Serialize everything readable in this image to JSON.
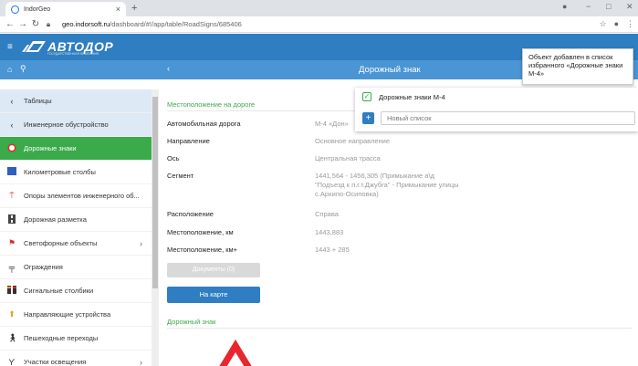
{
  "browser": {
    "tab_title": "IndorGeo",
    "tab_close": "×",
    "new_tab": "+",
    "url_domain": "geo.indorsoft.ru",
    "url_path": "/dashboard/#!/app/table/RoadSigns/685406",
    "win_min": "−",
    "win_max": "□",
    "win_close": "✕"
  },
  "header": {
    "logo_text": "АВТОДОР",
    "logo_sub": "ГОСУДАРСТВЕННАЯ КОМПАНИЯ",
    "page_title": "Дорожный знак"
  },
  "sidebar": {
    "items": [
      {
        "label": "Таблицы",
        "icon": "chevron-left-icon"
      },
      {
        "label": "Инженерное обустройство",
        "icon": "chevron-left-icon"
      },
      {
        "label": "Дорожные знаки",
        "icon": "road-sign-icon"
      },
      {
        "label": "Километровые столбы",
        "icon": "km-post-icon"
      },
      {
        "label": "Опоры элементов инженерного об...",
        "icon": "support-icon"
      },
      {
        "label": "Дорожная разметка",
        "icon": "road-marking-icon"
      },
      {
        "label": "Светофорные объекты",
        "icon": "traffic-light-icon"
      },
      {
        "label": "Ограждения",
        "icon": "fence-icon"
      },
      {
        "label": "Сигнальные столбики",
        "icon": "signal-post-icon"
      },
      {
        "label": "Направляющие устройства",
        "icon": "guide-device-icon"
      },
      {
        "label": "Пешеходные переходы",
        "icon": "pedestrian-icon"
      },
      {
        "label": "Участки освещения",
        "icon": "lighting-icon"
      }
    ]
  },
  "main": {
    "section_location": "Местоположение на дороге",
    "fields": [
      {
        "label": "Автомобильная дорога",
        "value": "М-4 «Дон»"
      },
      {
        "label": "Направление",
        "value": "Основное направление"
      },
      {
        "label": "Ось",
        "value": "Центральная трасса"
      },
      {
        "label": "Сегмент",
        "value": "1441,564 - 1456,305 (Примыкание а\\д \"Подъезд к п.г.т.Джубга\" - Примыкание улицы с.Архипо-Осиповка)"
      },
      {
        "label": "Расположение",
        "value": "Справа"
      },
      {
        "label": "Местоположение, км",
        "value": "1443,883"
      },
      {
        "label": "Местоположение, км+",
        "value": "1443 + 285"
      }
    ],
    "docs_button": "Документы (0)",
    "map_button": "На карте",
    "section_sign": "Дорожный знак"
  },
  "favorites_popup": {
    "list_label": "Дорожные знаки М-4",
    "new_list_placeholder": "Новый список"
  },
  "toast": {
    "message": "Объект добавлен в список избранного «Дорожные знаки М-4»"
  },
  "colors": {
    "header": "#2f7ec1",
    "subheader": "#4a95d3",
    "active": "#3aaa4a",
    "sign_red": "#e8262b"
  }
}
